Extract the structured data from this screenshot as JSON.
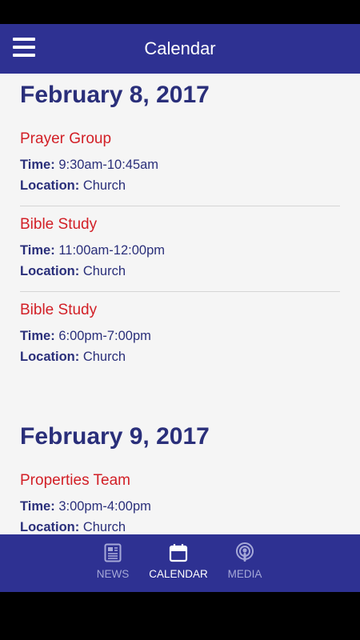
{
  "app_bar": {
    "title": "Calendar",
    "menu_icon": "hamburger-menu-icon"
  },
  "days": [
    {
      "date": "February 8, 2017",
      "events": [
        {
          "title": "Prayer Group",
          "time_label": "Time:",
          "time": "9:30am-10:45am",
          "location_label": "Location:",
          "location": "Church"
        },
        {
          "title": "Bible Study",
          "time_label": "Time:",
          "time": "11:00am-12:00pm",
          "location_label": "Location:",
          "location": "Church"
        },
        {
          "title": "Bible Study",
          "time_label": "Time:",
          "time": "6:00pm-7:00pm",
          "location_label": "Location:",
          "location": "Church"
        }
      ]
    },
    {
      "date": "February 9, 2017",
      "events": [
        {
          "title": "Properties Team",
          "time_label": "Time:",
          "time": "3:00pm-4:00pm",
          "location_label": "Location:",
          "location": "Church"
        }
      ]
    }
  ],
  "bottom_nav": {
    "items": [
      {
        "label": "NEWS",
        "icon": "newspaper-icon"
      },
      {
        "label": "CALENDAR",
        "icon": "calendar-icon",
        "active": true
      },
      {
        "label": "MEDIA",
        "icon": "podcast-icon"
      }
    ]
  },
  "colors": {
    "primary": "#2e3192",
    "heading": "#2a2f7a",
    "event_title": "#d21f26",
    "nav_inactive": "#a6a9d8"
  }
}
